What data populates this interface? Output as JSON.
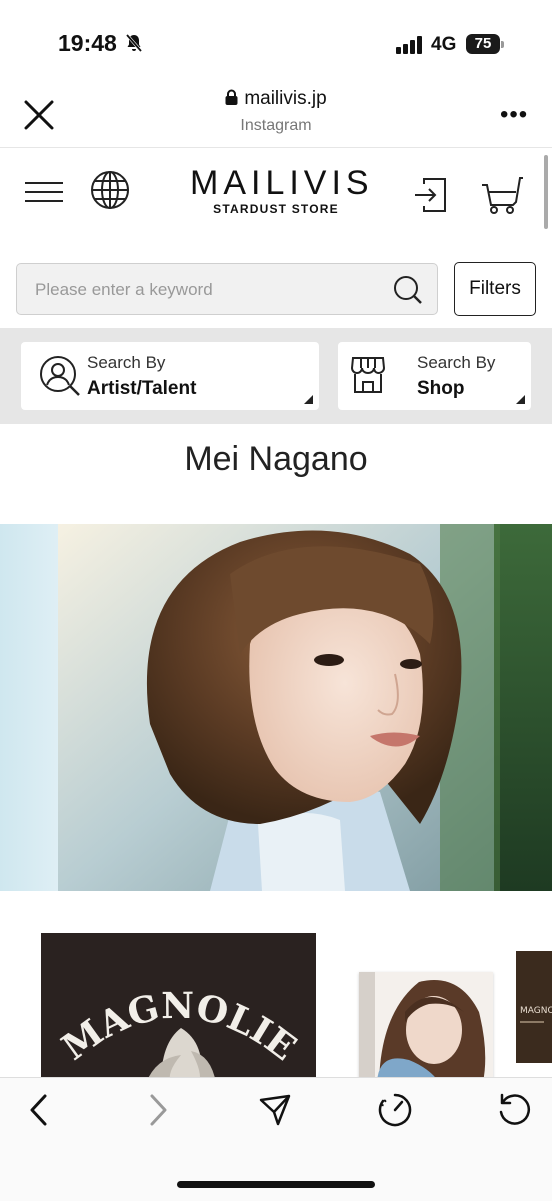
{
  "status_bar": {
    "time": "19:48",
    "network": "4G",
    "battery": "75"
  },
  "browser": {
    "domain": "mailivis.jp",
    "source": "Instagram",
    "more": "•••"
  },
  "site": {
    "logo_main": "MAILIVIS",
    "logo_sub": "STARDUST STORE",
    "search_placeholder": "Please enter a keyword",
    "filters_label": "Filters",
    "search_by_artist": {
      "small": "Search By",
      "big": "Artist/Talent"
    },
    "search_by_shop": {
      "small": "Search By",
      "big": "Shop"
    },
    "page_title": "Mei Nagano"
  },
  "products": [
    {
      "artwork_text": "MAGNOLIE"
    },
    {
      "artwork_text": ""
    },
    {
      "artwork_text": "MAGNOLIE"
    }
  ],
  "icons": [
    "bell-slash-icon",
    "signal-icon",
    "lock-icon",
    "close-icon",
    "more-icon",
    "hamburger-icon",
    "globe-icon",
    "login-icon",
    "cart-icon",
    "search-icon",
    "person-search-icon",
    "shop-icon",
    "back-icon",
    "forward-icon",
    "share-icon",
    "speed-icon",
    "reload-icon"
  ],
  "colors": {
    "band_bg": "#e6e6e6",
    "search_bg": "#f1f1f1",
    "text": "#222222"
  }
}
